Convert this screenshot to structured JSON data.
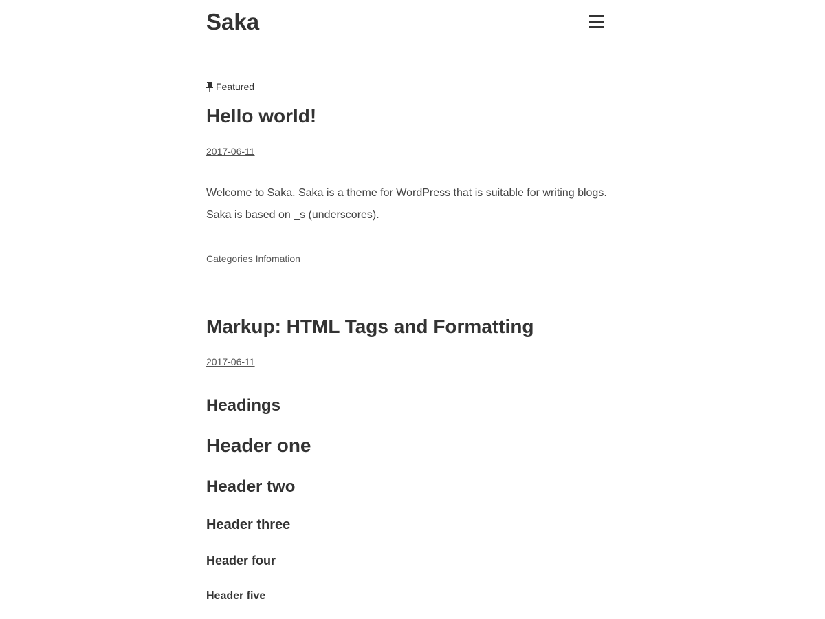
{
  "site": {
    "title": "Saka",
    "menu_icon": "hamburger-menu-icon"
  },
  "posts": [
    {
      "badge": "Featured",
      "badge_icon": "pin-icon",
      "title": "Hello world!",
      "date": "2017-06-11",
      "body": [
        "Welcome to Saka. Saka is a theme for WordPress that is suitable for writing blogs.",
        "Saka is based on _s (underscores)."
      ],
      "categories_label": "Categories",
      "category": "Infomation"
    },
    {
      "title": "Markup: HTML Tags and Formatting",
      "date": "2017-06-11",
      "headings": [
        "Headings",
        "Header one",
        "Header two",
        "Header three",
        "Header four",
        "Header five"
      ]
    }
  ]
}
